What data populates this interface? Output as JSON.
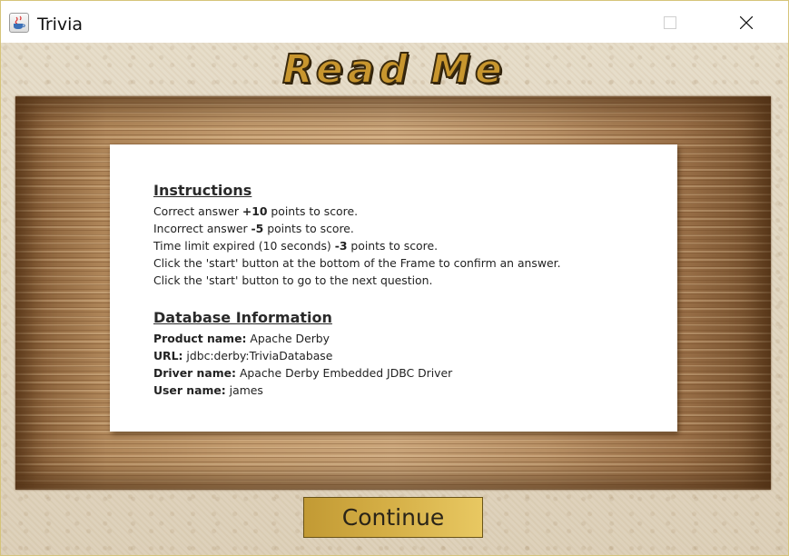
{
  "window": {
    "title": "Trivia",
    "icon": "java-cup-icon",
    "controls": [
      "minimize-icon",
      "maximize-icon",
      "close-icon"
    ]
  },
  "heading": "Read Me",
  "instructions": {
    "title": "Instructions",
    "lines": [
      {
        "pre": "Correct answer ",
        "bold": "+10",
        "post": " points to score."
      },
      {
        "pre": "Incorrect answer ",
        "bold": "-5",
        "post": " points to score."
      },
      {
        "pre": "Time limit expired (10 seconds) ",
        "bold": "-3",
        "post": " points to score."
      },
      {
        "pre": "Click the 'start' button at the bottom of the Frame to confirm an answer.",
        "bold": "",
        "post": ""
      },
      {
        "pre": "Click the 'start' button to go to the next question.",
        "bold": "",
        "post": ""
      }
    ]
  },
  "database": {
    "title": "Database Information",
    "fields": [
      {
        "label": "Product name:",
        "value": " Apache Derby"
      },
      {
        "label": "URL:",
        "value": " jdbc:derby:TriviaDatabase"
      },
      {
        "label": "Driver name:",
        "value": " Apache Derby Embedded JDBC Driver"
      },
      {
        "label": "User name:",
        "value": " james"
      }
    ]
  },
  "continue_label": "Continue",
  "colors": {
    "heading_gold": "#c8962e",
    "button_gold": "#d4ae45",
    "wood": "#b0875a",
    "window_border": "#d6c47a"
  }
}
